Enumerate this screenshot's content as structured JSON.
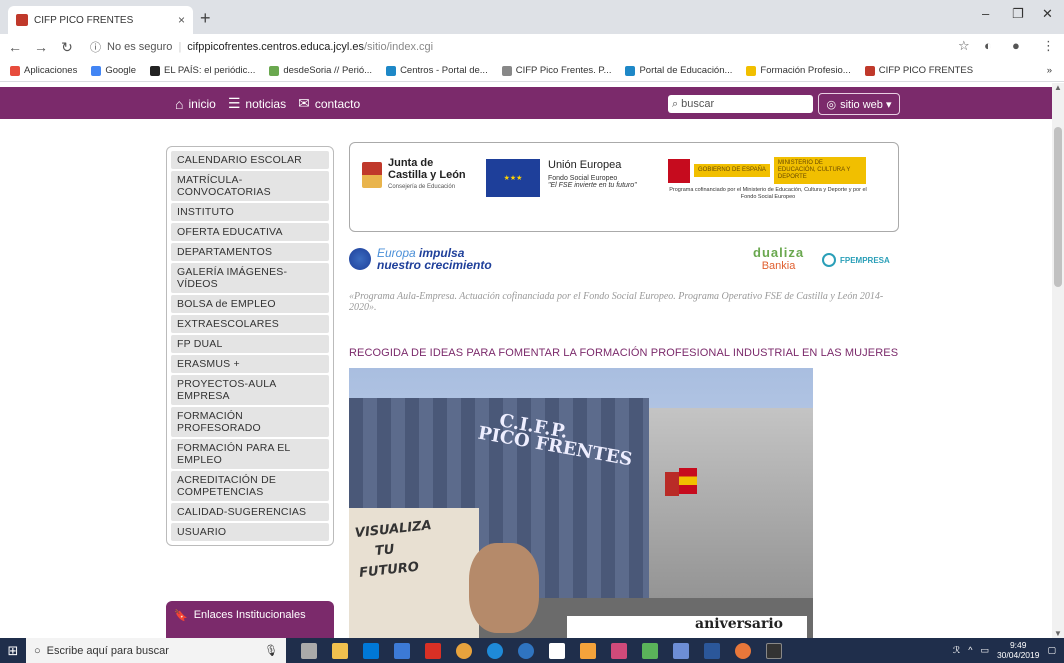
{
  "browser": {
    "tab_title": "CIFP PICO FRENTES",
    "tab_close": "×",
    "new_tab": "+",
    "url_security": "No es seguro",
    "url_host": "cifppicofrentes.centros.educa.jcyl.es",
    "url_path": "/sitio/index.cgi",
    "bookmarks": [
      {
        "label": "Aplicaciones",
        "color": "#e74c3c"
      },
      {
        "label": "Google",
        "color": "#4285f4"
      },
      {
        "label": "EL PAÍS: el periódic...",
        "color": "#222222"
      },
      {
        "label": "desdeSoria // Perió...",
        "color": "#6aa84f"
      },
      {
        "label": "Centros - Portal de...",
        "color": "#1e88c7"
      },
      {
        "label": "CIFP Pico Frentes. P...",
        "color": "#888888"
      },
      {
        "label": "Portal de Educación...",
        "color": "#1e88c7"
      },
      {
        "label": "Formación Profesio...",
        "color": "#f1bf00"
      },
      {
        "label": "CIFP PICO FRENTES",
        "color": "#c0392b"
      }
    ]
  },
  "site": {
    "nav": {
      "home": "inicio",
      "news": "noticias",
      "contact": "contacto"
    },
    "search_placeholder": "buscar",
    "site_button": "sitio web ▾",
    "sidebar": [
      "CALENDARIO ESCOLAR",
      "MATRÍCULA-\nCONVOCATORIAS",
      "INSTITUTO",
      "OFERTA EDUCATIVA",
      "DEPARTAMENTOS",
      "GALERÍA IMÁGENES-\nVÍDEOS",
      "BOLSA de EMPLEO",
      "EXTRAESCOLARES",
      "FP DUAL",
      "ERASMUS +",
      "PROYECTOS-AULA\nEMPRESA",
      "FORMACIÓN\nPROFESORADO",
      "FORMACIÓN PARA EL\nEMPLEO",
      "ACREDITACIÓN DE\nCOMPETENCIAS",
      "CALIDAD-SUGERENCIAS",
      "USUARIO"
    ],
    "links_title": "Enlaces Institucionales",
    "logos": {
      "jcyl_line1": "Junta de",
      "jcyl_line2": "Castilla y León",
      "jcyl_sub": "Consejería de Educación",
      "eu_title": "Unión Europea",
      "eu_fund": "Fondo Social Europeo",
      "eu_motto": "\"El FSE invierte en tu futuro\"",
      "gob_1": "GOBIERNO DE ESPAÑA",
      "gob_2": "MINISTERIO DE EDUCACIÓN, CULTURA Y DEPORTE",
      "gob_prog": "Programa cofinanciado por el Ministerio de Educación, Cultura y Deporte y por el Fondo Social Europeo",
      "europa_1": "Europa",
      "europa_2": "impulsa",
      "europa_3": "nuestro crecimiento",
      "dualiza": "dualiza",
      "bankia": "Bankia",
      "fpempresa": "FPEMPRESA"
    },
    "program_text": "«Programa Aula-Empresa. Actuación cofinanciada por el Fondo Social Europeo. Programa Operativo FSE de Castilla y León 2014-2020».",
    "headline": "RECOGIDA DE IDEAS PARA FOMENTAR LA FORMACIÓN PROFESIONAL INDUSTRIAL EN LAS MUJERES",
    "photo": {
      "sign_1": "C.I.F.P.",
      "sign_2": "PICO FRENTES",
      "poster_1": "VISUALIZA",
      "poster_2": "TU",
      "poster_3": "FUTURO",
      "banner": "aniversario"
    }
  },
  "taskbar": {
    "search_placeholder": "Escribe aquí para buscar",
    "time": "9:49",
    "date": "30/04/2019"
  }
}
